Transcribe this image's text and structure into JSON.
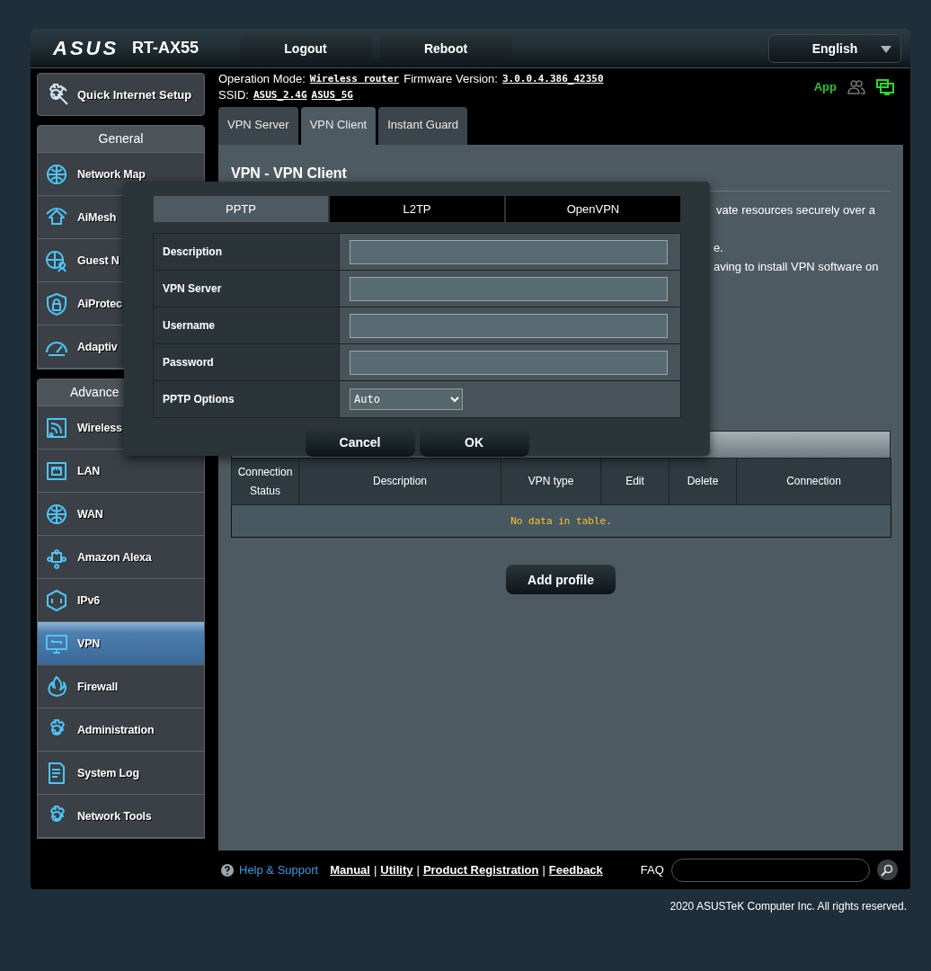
{
  "header": {
    "logo": "ASUS",
    "model": "RT-AX55",
    "buttons": [
      "Logout",
      "Reboot"
    ],
    "language": "English"
  },
  "status": {
    "operation_mode_label": "Operation Mode:",
    "operation_mode": "Wireless router",
    "firmware_label": "Firmware Version:",
    "firmware": "3.0.0.4.386_42350",
    "ssid_label": "SSID:",
    "ssids": [
      "ASUS_2.4G",
      "ASUS_5G"
    ],
    "app": "App"
  },
  "sidebar": {
    "quick_setup": "Quick Internet Setup",
    "sections": [
      {
        "title": "General",
        "items": [
          {
            "label": "Network Map",
            "selected": false
          },
          {
            "label": "AiMesh",
            "selected": false
          },
          {
            "label": "Guest N",
            "selected": false
          },
          {
            "label": "AiProtec",
            "selected": false
          },
          {
            "label": "Adaptiv",
            "selected": false
          }
        ]
      },
      {
        "title": "Advance",
        "items": [
          {
            "label": "Wireless",
            "selected": false
          },
          {
            "label": "LAN",
            "selected": false
          },
          {
            "label": "WAN",
            "selected": false
          },
          {
            "label": "Amazon Alexa",
            "selected": false
          },
          {
            "label": "IPv6",
            "selected": false
          },
          {
            "label": "VPN",
            "selected": true
          },
          {
            "label": "Firewall",
            "selected": false
          },
          {
            "label": "Administration",
            "selected": false
          },
          {
            "label": "System Log",
            "selected": false
          },
          {
            "label": "Network Tools",
            "selected": false
          }
        ]
      }
    ]
  },
  "tabs": [
    {
      "label": "VPN Server",
      "selected": false
    },
    {
      "label": "VPN Client",
      "selected": true
    },
    {
      "label": "Instant Guard",
      "selected": false
    }
  ],
  "content": {
    "title": "VPN - VPN Client",
    "description_lines": [
      "vate resources securely over a",
      "e.",
      "aving to install VPN software on"
    ],
    "table": {
      "columns": [
        "Connection Status",
        "Description",
        "VPN type",
        "Edit",
        "Delete",
        "Connection"
      ],
      "empty_message": "No data in table."
    },
    "add_button": "Add profile"
  },
  "modal": {
    "tabs": [
      {
        "label": "PPTP",
        "selected": true
      },
      {
        "label": "L2TP",
        "selected": false
      },
      {
        "label": "OpenVPN",
        "selected": false
      }
    ],
    "fields": [
      {
        "label": "Description",
        "kind": "text"
      },
      {
        "label": "VPN Server",
        "kind": "text"
      },
      {
        "label": "Username",
        "kind": "text"
      },
      {
        "label": "Password",
        "kind": "password"
      },
      {
        "label": "PPTP Options",
        "kind": "select",
        "value": "Auto"
      }
    ],
    "buttons": [
      "Cancel",
      "OK"
    ]
  },
  "footer": {
    "help": "Help & Support",
    "links": [
      "Manual",
      "Utility",
      "Product Registration",
      "Feedback"
    ],
    "link_separator": "|",
    "faq": "FAQ",
    "copyright": "2020 ASUSTeK Computer Inc. All rights reserved."
  }
}
